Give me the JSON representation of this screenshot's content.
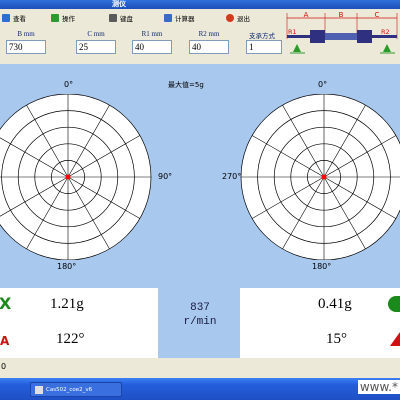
{
  "window": {
    "title": "测仪"
  },
  "menu": [
    {
      "label": "查看",
      "icon": "view-icon",
      "color": "#2a6fd1"
    },
    {
      "label": "操作",
      "icon": "operate-icon",
      "color": "#2d9a2d"
    },
    {
      "label": "键盘",
      "icon": "keyboard-icon",
      "color": "#5a5a5a"
    },
    {
      "label": "计算器",
      "icon": "calculator-icon",
      "color": "#3a6ac8"
    },
    {
      "label": "退出",
      "icon": "exit-icon",
      "color": "#d23a1c"
    }
  ],
  "params": [
    {
      "label": "B mm",
      "value": "730"
    },
    {
      "label": "C mm",
      "value": "25"
    },
    {
      "label": "R1 mm",
      "value": "40"
    },
    {
      "label": "R2 mm",
      "value": "40"
    },
    {
      "label": "支承方式",
      "value": "1"
    }
  ],
  "diagram": {
    "labels": {
      "a": "A",
      "b": "B",
      "c": "C",
      "r1": "R1",
      "r2": "R2"
    },
    "colors": {
      "dimension": "#d01010",
      "shaft": "#303080",
      "support": "#2a9a2a"
    }
  },
  "polar": {
    "max_label": "最大值=5g",
    "left": {
      "top": "0°",
      "right": "90°",
      "bottom": "180°"
    },
    "right": {
      "top": "0°",
      "left": "270°",
      "bottom": "180°"
    },
    "rings": 5,
    "spokes": 12,
    "center_color": "#ff0000",
    "background": "#a8c8ee"
  },
  "readout": {
    "left": {
      "amplitude": "1.21g",
      "phase": "122°",
      "mark_top": "X",
      "mark_bottom": "A"
    },
    "speed": {
      "value": "837",
      "unit": "r/min"
    },
    "right": {
      "amplitude": "0.41g",
      "phase": "15°"
    },
    "colors": {
      "mark_green": "#1a8a1a",
      "mark_red": "#d01010"
    }
  },
  "status": {
    "text": "0"
  },
  "taskbar": {
    "task_label": "Cas502_coe2_v6",
    "watermark": "www.*"
  }
}
